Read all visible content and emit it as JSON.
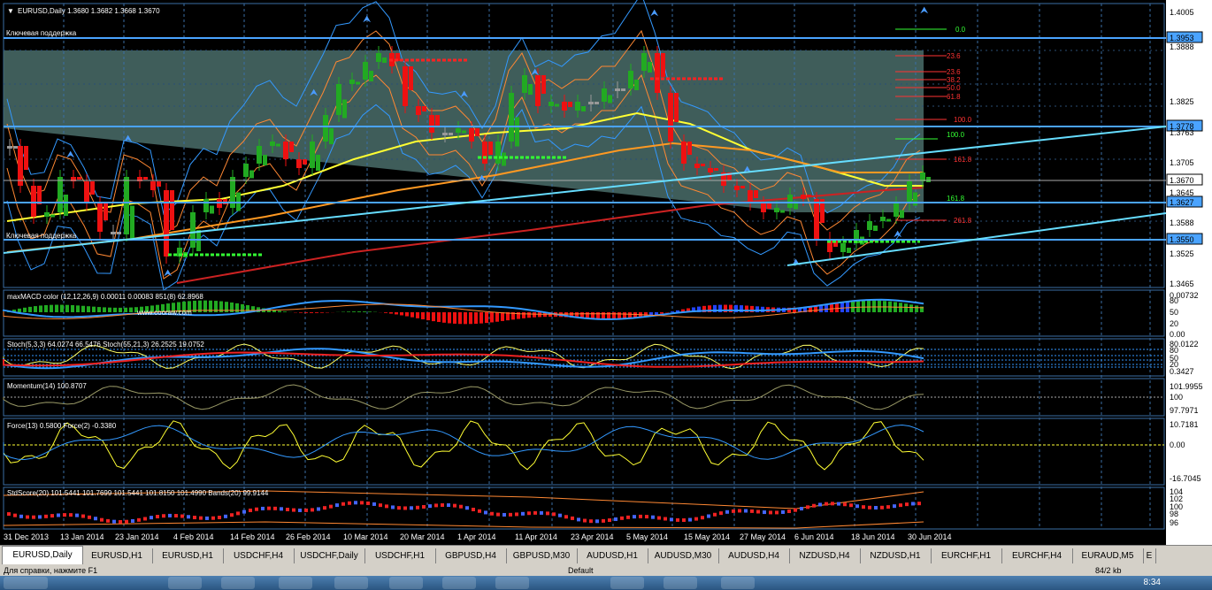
{
  "chart": {
    "title": "EURUSD,Daily  1.3680 1.3682 1.3668 1.3670",
    "support_label_top": "Ключевая поддержка",
    "support_label_bottom": "Ключевая поддержка",
    "price_axis": [
      "1.4005",
      "1.3953",
      "1.3888",
      "1.3825",
      "1.3778",
      "1.3763",
      "1.3705",
      "1.3670",
      "1.3645",
      "1.3627",
      "1.3588",
      "1.3550",
      "1.3525",
      "1.3465"
    ],
    "hlines": [
      {
        "price": "1.3953",
        "label": "1.3953"
      },
      {
        "price": "1.3778",
        "label": "1.3778"
      },
      {
        "price": "1.3627",
        "label": "1.3627"
      },
      {
        "price": "1.3550",
        "label": "1.3550"
      }
    ],
    "current_price": "1.3670",
    "fib_labels": [
      "0.0",
      "23.6",
      "38.2",
      "50.0",
      "61.8",
      "100.0",
      "161.8",
      "261.8"
    ],
    "fib_labels_second": [
      "100.0",
      "161.8"
    ],
    "dates": [
      "31 Dec 2013",
      "13 Jan 2014",
      "23 Jan 2014",
      "4 Feb 2014",
      "14 Feb 2014",
      "26 Feb 2014",
      "10 Mar 2014",
      "20 Mar 2014",
      "1 Apr 2014",
      "11 Apr 2014",
      "23 Apr 2014",
      "5 May 2014",
      "15 May 2014",
      "27 May 2014",
      "6 Jun 2014",
      "18 Jun 2014",
      "30 Jun 2014"
    ]
  },
  "panels": {
    "macd": {
      "label": "maxMACD color (12,12,26,9) 0.00011  0.00083  851(8) 62.8968",
      "axis": [
        "0.00732",
        "80",
        "50",
        "20",
        "0.00"
      ]
    },
    "stoch": {
      "label": "Stoch(5,3,3) 64.0274 66.5476  Stoch(55,21,3) 26.2525 19.0752",
      "axis": [
        "80.0122",
        "80",
        "50",
        "20",
        "0.3427"
      ]
    },
    "momentum": {
      "label": "Momentum(14) 100.8707",
      "axis": [
        "101.9955",
        "100",
        "97.7971"
      ]
    },
    "force": {
      "label": "Force(13) 0.5800  Force(2) -0.3380",
      "axis": [
        "10.7181",
        "0.00",
        "-16.7045"
      ]
    },
    "stdscore": {
      "label": "StdScore(20) 101.5441 101.7699 101.5441 101.8150 101.4990  Bands(20) 99.9144",
      "axis": [
        "104",
        "102",
        "100",
        "98",
        "96"
      ]
    }
  },
  "watermark": "www.cooraw.com",
  "tabs": [
    "EURUSD,Daily",
    "EURUSD,H1",
    "EURUSD,H1",
    "USDCHF,H4",
    "USDCHF,Daily",
    "USDCHF,H1",
    "GBPUSD,H4",
    "GBPUSD,M30",
    "AUDUSD,H1",
    "AUDUSD,M30",
    "AUDUSD,H4",
    "NZDUSD,H4",
    "NZDUSD,H1",
    "EURCHF,H1",
    "EURCHF,H4",
    "EURAUD,M5",
    "E"
  ],
  "status": {
    "help": "Для справки, нажмите F1",
    "profile": "Default",
    "traffic": "84/2 kb"
  },
  "taskbar": {
    "time": "8:34"
  },
  "colors": {
    "background": "#000000",
    "grid": "#3a6ea5",
    "trend": "#66ccff",
    "hline": "#4aa3ff",
    "bull": "#22aa22",
    "bear": "#ee1111",
    "doji": "#999999",
    "fib": "#ff3333",
    "fib_green": "#33ff33"
  }
}
